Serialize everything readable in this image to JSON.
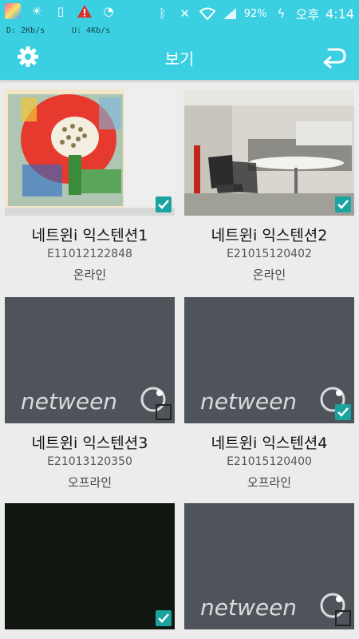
{
  "statusbar": {
    "battery": "92%",
    "ampm": "오후",
    "time": "4:14"
  },
  "netspeed": {
    "download": "D: 2Kb/s",
    "upload": "U: 4Kb/s"
  },
  "appbar": {
    "title": "보기"
  },
  "devices": [
    {
      "name": "네트윈i 익스텐션1",
      "serial": "E11012122848",
      "status": "온라인",
      "checked": true
    },
    {
      "name": "네트윈i 익스텐션2",
      "serial": "E21015120402",
      "status": "온라인",
      "checked": true
    },
    {
      "name": "네트윈i 익스텐션3",
      "serial": "E21013120350",
      "status": "오프라인",
      "checked": false
    },
    {
      "name": "네트윈i 익스텐션4",
      "serial": "E21015120400",
      "status": "오프라인",
      "checked": true
    },
    {
      "name": "",
      "serial": "",
      "status": "",
      "checked": true
    },
    {
      "name": "",
      "serial": "",
      "status": "",
      "checked": false
    }
  ],
  "logo_text": "netween",
  "colors": {
    "accent": "#3ad0e2",
    "checkbox": "#1aa3a0"
  }
}
